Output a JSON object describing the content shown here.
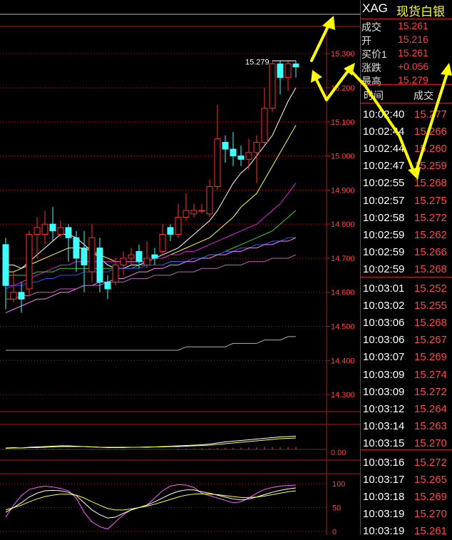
{
  "chart_data": [
    {
      "type": "candlestick",
      "ylim": [
        14.25,
        15.38
      ],
      "y_ticks": [
        "15.300",
        "15.200",
        "15.100",
        "15.000",
        "14.900",
        "14.800",
        "14.700",
        "14.600",
        "14.500",
        "14.400",
        "14.300"
      ],
      "y_tick_values": [
        15.3,
        15.2,
        15.1,
        15.0,
        14.9,
        14.8,
        14.7,
        14.6,
        14.5,
        14.4,
        14.3
      ],
      "high_marker": "15.279",
      "candles": [
        [
          14.74,
          14.62,
          14.76,
          14.55
        ],
        [
          14.58,
          14.6,
          14.66,
          14.57
        ],
        [
          14.6,
          14.58,
          14.63,
          14.54
        ],
        [
          14.61,
          14.77,
          14.78,
          14.59
        ],
        [
          14.77,
          14.79,
          14.82,
          14.7
        ],
        [
          14.77,
          14.8,
          14.84,
          14.74
        ],
        [
          14.8,
          14.78,
          14.85,
          14.75
        ],
        [
          14.77,
          14.79,
          14.81,
          14.76
        ],
        [
          14.79,
          14.76,
          14.8,
          14.69
        ],
        [
          14.76,
          14.7,
          14.78,
          14.66
        ],
        [
          14.73,
          14.68,
          14.78,
          14.6
        ],
        [
          14.66,
          14.76,
          14.8,
          14.63
        ],
        [
          14.73,
          14.63,
          14.76,
          14.6
        ],
        [
          14.63,
          14.61,
          14.65,
          14.58
        ],
        [
          14.63,
          14.68,
          14.7,
          14.62
        ],
        [
          14.68,
          14.7,
          14.72,
          14.65
        ],
        [
          14.7,
          14.71,
          14.73,
          14.68
        ],
        [
          14.72,
          14.69,
          14.74,
          14.67
        ],
        [
          14.68,
          14.7,
          14.75,
          14.67
        ],
        [
          14.71,
          14.7,
          14.73,
          14.68
        ],
        [
          14.72,
          14.77,
          14.8,
          14.71
        ],
        [
          14.79,
          14.77,
          14.8,
          14.75
        ],
        [
          14.77,
          14.82,
          14.86,
          14.76
        ],
        [
          14.82,
          14.84,
          14.89,
          14.81
        ],
        [
          14.83,
          14.84,
          14.86,
          14.82
        ],
        [
          14.84,
          14.84,
          14.86,
          14.83
        ],
        [
          14.83,
          14.91,
          14.93,
          14.82
        ],
        [
          14.91,
          15.05,
          15.15,
          14.9
        ],
        [
          15.04,
          15.02,
          15.06,
          14.98
        ],
        [
          15.02,
          15.0,
          15.07,
          14.97
        ],
        [
          15.0,
          14.99,
          15.03,
          14.97
        ],
        [
          14.99,
          15.01,
          15.05,
          14.96
        ],
        [
          15.01,
          15.04,
          15.06,
          14.92
        ],
        [
          15.04,
          15.14,
          15.2,
          15.03
        ],
        [
          15.14,
          15.27,
          15.28,
          15.13
        ],
        [
          15.27,
          15.23,
          15.28,
          15.18
        ],
        [
          15.23,
          15.27,
          15.28,
          15.19
        ],
        [
          15.27,
          15.261,
          15.279,
          15.23
        ]
      ],
      "moving_averages": [
        {
          "color": "#ffffff",
          "values": [
            14.68,
            14.68,
            14.67,
            14.69,
            14.71,
            14.73,
            14.75,
            14.77,
            14.77,
            14.76,
            14.74,
            14.72,
            14.7,
            14.68,
            14.67,
            14.67,
            14.68,
            14.68,
            14.69,
            14.7,
            14.71,
            14.72,
            14.73,
            14.75,
            14.77,
            14.79,
            14.81,
            14.84,
            14.88,
            14.92,
            14.95,
            14.97,
            15.0,
            15.03,
            15.06,
            15.11,
            15.16,
            15.2
          ]
        },
        {
          "color": "#ffff40",
          "values": [
            14.66,
            14.66,
            14.67,
            14.68,
            14.69,
            14.7,
            14.71,
            14.72,
            14.73,
            14.73,
            14.73,
            14.72,
            14.71,
            14.7,
            14.69,
            14.69,
            14.69,
            14.69,
            14.69,
            14.7,
            14.7,
            14.71,
            14.72,
            14.73,
            14.74,
            14.75,
            14.76,
            14.78,
            14.8,
            14.82,
            14.85,
            14.87,
            14.89,
            14.93,
            14.97,
            15.01,
            15.05,
            15.09
          ]
        },
        {
          "color": "#e020e0",
          "values": [
            14.62,
            14.62,
            14.63,
            14.64,
            14.65,
            14.66,
            14.67,
            14.68,
            14.68,
            14.69,
            14.69,
            14.69,
            14.69,
            14.69,
            14.69,
            14.69,
            14.69,
            14.69,
            14.69,
            14.7,
            14.7,
            14.71,
            14.71,
            14.72,
            14.72,
            14.73,
            14.74,
            14.75,
            14.76,
            14.77,
            14.78,
            14.79,
            14.8,
            14.82,
            14.84,
            14.86,
            14.89,
            14.92
          ]
        },
        {
          "color": "#30d030",
          "values": [
            14.65,
            14.65,
            14.65,
            14.65,
            14.66,
            14.66,
            14.66,
            14.67,
            14.67,
            14.67,
            14.67,
            14.67,
            14.67,
            14.67,
            14.67,
            14.67,
            14.67,
            14.68,
            14.68,
            14.68,
            14.68,
            14.69,
            14.69,
            14.69,
            14.7,
            14.7,
            14.71,
            14.71,
            14.72,
            14.73,
            14.74,
            14.75,
            14.76,
            14.77,
            14.78,
            14.8,
            14.82,
            14.84
          ]
        },
        {
          "color": "#3050ff",
          "values": [
            14.61,
            14.62,
            14.62,
            14.63,
            14.63,
            14.64,
            14.64,
            14.65,
            14.65,
            14.65,
            14.66,
            14.66,
            14.66,
            14.66,
            14.67,
            14.67,
            14.67,
            14.67,
            14.68,
            14.68,
            14.68,
            14.69,
            14.69,
            14.69,
            14.7,
            14.7,
            14.71,
            14.71,
            14.72,
            14.72,
            14.73,
            14.73,
            14.74,
            14.74,
            14.75,
            14.75,
            14.76,
            14.76
          ]
        },
        {
          "color": "#ff80ff",
          "values": [
            14.54,
            14.55,
            14.56,
            14.57,
            14.58,
            14.58,
            14.59,
            14.6,
            14.6,
            14.61,
            14.62,
            14.62,
            14.63,
            14.63,
            14.64,
            14.64,
            14.65,
            14.66,
            14.66,
            14.67,
            14.67,
            14.68,
            14.68,
            14.69,
            14.69,
            14.7,
            14.7,
            14.71,
            14.71,
            14.72,
            14.72,
            14.73,
            14.73,
            14.74,
            14.74,
            14.75,
            14.75,
            14.76
          ]
        },
        {
          "color": "#c060c0",
          "values": [
            14.58,
            14.58,
            14.59,
            14.59,
            14.6,
            14.6,
            14.6,
            14.61,
            14.61,
            14.61,
            14.62,
            14.62,
            14.62,
            14.63,
            14.63,
            14.63,
            14.64,
            14.64,
            14.64,
            14.65,
            14.65,
            14.65,
            14.66,
            14.66,
            14.66,
            14.67,
            14.67,
            14.67,
            14.68,
            14.68,
            14.68,
            14.69,
            14.69,
            14.69,
            14.7,
            14.7,
            14.7,
            14.71
          ]
        },
        {
          "color": "#b0b0b0",
          "values": [
            14.43,
            14.43,
            14.43,
            14.43,
            14.43,
            14.43,
            14.43,
            14.43,
            14.43,
            14.43,
            14.43,
            14.43,
            14.43,
            14.43,
            14.43,
            14.43,
            14.43,
            14.43,
            14.43,
            14.43,
            14.43,
            14.43,
            14.43,
            14.44,
            14.44,
            14.44,
            14.44,
            14.44,
            14.44,
            14.45,
            14.45,
            14.45,
            14.45,
            14.46,
            14.46,
            14.46,
            14.47,
            14.47
          ]
        }
      ]
    },
    {
      "type": "line",
      "y_ticks": [
        "0.00"
      ],
      "series": [
        {
          "color": "#ffffff",
          "values": [
            0.004,
            0.005,
            0.004,
            0.006,
            0.007,
            0.008,
            0.009,
            0.01,
            0.01,
            0.009,
            0.008,
            0.007,
            0.006,
            0.005,
            0.005,
            0.005,
            0.006,
            0.006,
            0.007,
            0.007,
            0.008,
            0.009,
            0.01,
            0.011,
            0.012,
            0.013,
            0.015,
            0.018,
            0.021,
            0.023,
            0.025,
            0.027,
            0.029,
            0.031,
            0.033,
            0.035,
            0.036,
            0.037
          ]
        },
        {
          "color": "#ffff40",
          "values": [
            0.003,
            0.004,
            0.004,
            0.005,
            0.005,
            0.006,
            0.007,
            0.008,
            0.008,
            0.008,
            0.008,
            0.007,
            0.006,
            0.006,
            0.006,
            0.006,
            0.006,
            0.006,
            0.006,
            0.007,
            0.007,
            0.008,
            0.008,
            0.009,
            0.01,
            0.011,
            0.012,
            0.014,
            0.016,
            0.018,
            0.02,
            0.022,
            0.024,
            0.026,
            0.028,
            0.03,
            0.031,
            0.032
          ]
        }
      ],
      "bars": [
        0.001,
        0.001,
        0.001,
        0.001,
        0.002,
        0.002,
        0.002,
        0.002,
        0.002,
        0.001,
        0.0,
        -0.001,
        -0.001,
        -0.001,
        -0.001,
        -0.001,
        0.0,
        0.0,
        0.001,
        0.001,
        0.001,
        0.001,
        0.002,
        0.002,
        0.002,
        0.003,
        0.003,
        0.004,
        0.005,
        0.005,
        0.005,
        0.006,
        0.006,
        0.007,
        0.007,
        0.007,
        0.007,
        0.007
      ]
    },
    {
      "type": "line",
      "y_ticks": [
        "100",
        "50",
        "0"
      ],
      "y_tick_values": [
        100,
        50,
        0
      ],
      "series": [
        {
          "color": "#ff60ff",
          "values": [
            30,
            55,
            75,
            88,
            92,
            95,
            93,
            90,
            85,
            70,
            40,
            20,
            10,
            5,
            20,
            35,
            45,
            50,
            55,
            70,
            85,
            95,
            98,
            97,
            92,
            80,
            75,
            70,
            65,
            60,
            62,
            70,
            80,
            88,
            92,
            95,
            96,
            97
          ]
        },
        {
          "color": "#ffffff",
          "values": [
            40,
            50,
            60,
            72,
            80,
            85,
            86,
            85,
            82,
            75,
            60,
            45,
            35,
            28,
            30,
            38,
            45,
            50,
            55,
            62,
            70,
            78,
            84,
            87,
            87,
            83,
            80,
            76,
            72,
            68,
            66,
            68,
            72,
            77,
            82,
            86,
            89,
            91
          ]
        },
        {
          "color": "#ffff40",
          "values": [
            45,
            50,
            55,
            62,
            68,
            73,
            76,
            78,
            78,
            76,
            70,
            62,
            55,
            48,
            45,
            45,
            47,
            50,
            53,
            57,
            62,
            67,
            72,
            76,
            78,
            79,
            78,
            77,
            75,
            73,
            71,
            71,
            72,
            74,
            77,
            80,
            83,
            85
          ]
        }
      ]
    }
  ],
  "panel": {
    "symbol": "XAG",
    "name": "现货白银",
    "quote": [
      {
        "label": "成交",
        "value": "15.261"
      },
      {
        "label": "开",
        "value": "15.216"
      },
      {
        "label": "买价1",
        "value": "15.261"
      },
      {
        "label": "涨跌",
        "value": "+0.056"
      },
      {
        "label": "最高",
        "value": "15.279"
      }
    ],
    "ticks_header": {
      "time": "时间",
      "price": "成交"
    },
    "ticks": [
      {
        "time": "10:02:40",
        "price": "15.277"
      },
      {
        "time": "10:02:44",
        "price": "15.266"
      },
      {
        "time": "10:02:44",
        "price": "15.260"
      },
      {
        "time": "10:02:47",
        "price": "15.259"
      },
      {
        "time": "10:02:55",
        "price": "15.268"
      },
      {
        "time": "10:02:57",
        "price": "15.275"
      },
      {
        "time": "10:02:58",
        "price": "15.272"
      },
      {
        "time": "10:02:59",
        "price": "15.262"
      },
      {
        "time": "10:02:59",
        "price": "15.266"
      },
      {
        "time": "10:02:59",
        "price": "15.268"
      },
      {
        "time": "10:03:01",
        "price": "15.252"
      },
      {
        "time": "10:03:02",
        "price": "15.255"
      },
      {
        "time": "10:03:06",
        "price": "15.268"
      },
      {
        "time": "10:03:06",
        "price": "15.267"
      },
      {
        "time": "10:03:07",
        "price": "15.269"
      },
      {
        "time": "10:03:09",
        "price": "15.274"
      },
      {
        "time": "10:03:09",
        "price": "15.272"
      },
      {
        "time": "10:03:12",
        "price": "15.264"
      },
      {
        "time": "10:03:14",
        "price": "15.263"
      },
      {
        "time": "10:03:15",
        "price": "15.270"
      },
      {
        "time": "10:03:16",
        "price": "15.272"
      },
      {
        "time": "10:03:17",
        "price": "15.265"
      },
      {
        "time": "10:03:18",
        "price": "15.269"
      },
      {
        "time": "10:03:19",
        "price": "15.270"
      },
      {
        "time": "10:03:19",
        "price": "15.261"
      }
    ]
  },
  "colors": {
    "up": "#ff3030",
    "down": "#40ffff",
    "grid": "#b01818",
    "annotation": "#ffff00"
  }
}
